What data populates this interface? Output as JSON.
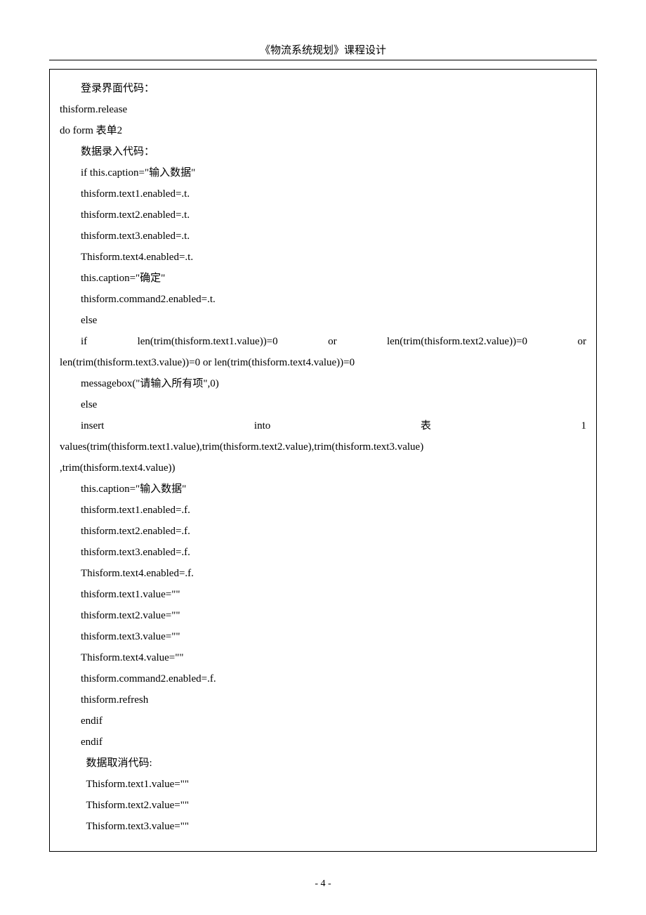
{
  "header": "《物流系统规划》课程设计",
  "footer": "- 4 -",
  "lines": {
    "l01": "登录界面代码：",
    "l02": "thisform.release",
    "l03": "do form 表单2",
    "l04": "数据录入代码：",
    "l05": "if this.caption=\"输入数据\"",
    "l06": "thisform.text1.enabled=.t.",
    "l07": "thisform.text2.enabled=.t.",
    "l08": "thisform.text3.enabled=.t.",
    "l09": "Thisform.text4.enabled=.t.",
    "l10": "this.caption=\"确定\"",
    "l11": "thisform.command2.enabled=.t.",
    "l12": "else",
    "l13a": "if",
    "l13b": "len(trim(thisform.text1.value))=0",
    "l13c": "or",
    "l13d": "len(trim(thisform.text2.value))=0",
    "l13e": "or",
    "l14": "len(trim(thisform.text3.value))=0 or len(trim(thisform.text4.value))=0",
    "l15": "messagebox(\"请输入所有项\",0)",
    "l16": "else",
    "l17a": "insert",
    "l17b": "into",
    "l17c": "表",
    "l17d": "1",
    "l18": "values(trim(thisform.text1.value),trim(thisform.text2.value),trim(thisform.text3.value)",
    "l19": ",trim(thisform.text4.value))",
    "l20": "this.caption=\"输入数据\"",
    "l21": "thisform.text1.enabled=.f.",
    "l22": "thisform.text2.enabled=.f.",
    "l23": "thisform.text3.enabled=.f.",
    "l24": "Thisform.text4.enabled=.f.",
    "l25": "thisform.text1.value=\"\"",
    "l26": "thisform.text2.value=\"\"",
    "l27": "thisform.text3.value=\"\"",
    "l28": "Thisform.text4.value=\"\"",
    "l29": "thisform.command2.enabled=.f.",
    "l30": "thisform.refresh",
    "l31": "endif",
    "l32": "endif",
    "l33": "数据取消代码:",
    "l34": "Thisform.text1.value=\"\"",
    "l35": "Thisform.text2.value=\"\"",
    "l36": "Thisform.text3.value=\"\""
  }
}
